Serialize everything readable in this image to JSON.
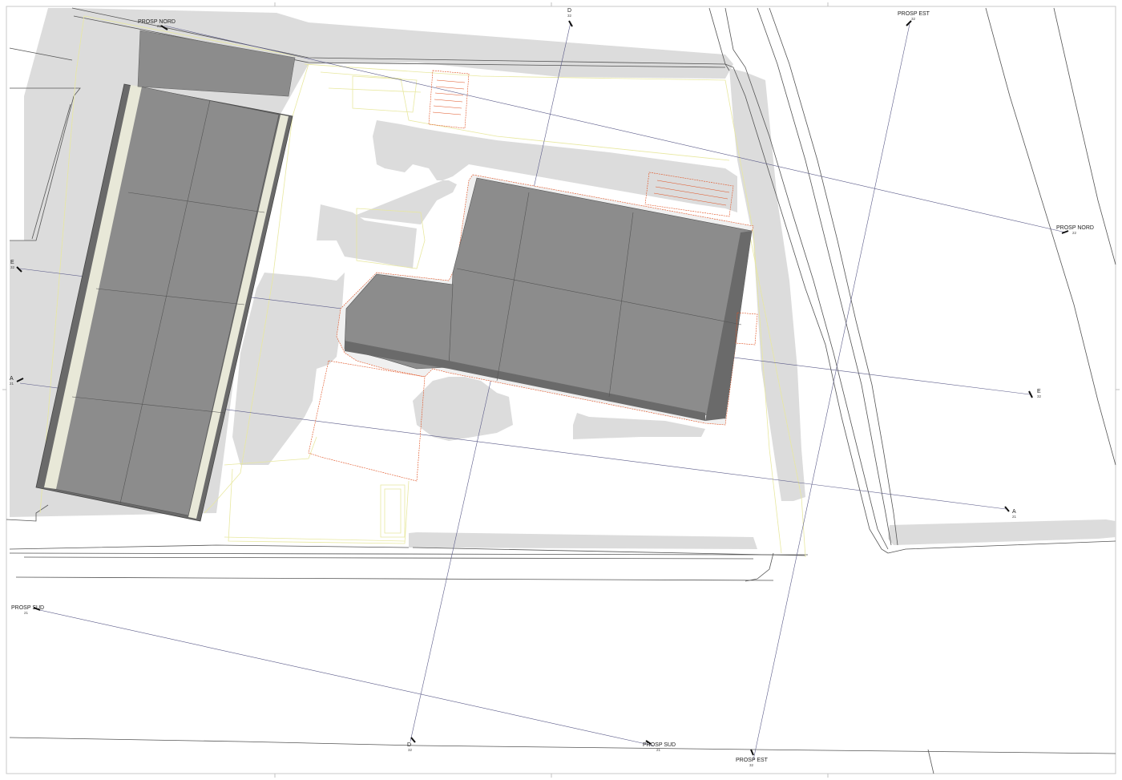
{
  "colors": {
    "background": "#ffffff",
    "shadow": "#dcdcdc",
    "roof": "#8c8c8c",
    "roof_dark": "#6a6a6a",
    "linework": "#555555",
    "construction": "#e8e8a0",
    "section_line": "#5a5a88",
    "red_detail": "#e05020"
  },
  "section_marks": [
    {
      "id": "prosp-nord-top",
      "label": "PROSP NORD",
      "sub": "22"
    },
    {
      "id": "prosp-nord-right",
      "label": "PROSP NORD",
      "sub": "22"
    },
    {
      "id": "prosp-est-top",
      "label": "PROSP EST",
      "sub": "32"
    },
    {
      "id": "prosp-est-bottom",
      "label": "PROSP EST",
      "sub": "32"
    },
    {
      "id": "prosp-sud-left",
      "label": "PROSP SUD",
      "sub": "21"
    },
    {
      "id": "prosp-sud-bottom",
      "label": "PROSP SUD",
      "sub": "21"
    },
    {
      "id": "d-top",
      "label": "D",
      "sub": "32"
    },
    {
      "id": "d-bottom",
      "label": "D",
      "sub": "32"
    },
    {
      "id": "e-left",
      "label": "E",
      "sub": "32"
    },
    {
      "id": "e-right",
      "label": "E",
      "sub": "32"
    },
    {
      "id": "a-left",
      "label": "A",
      "sub": "21"
    },
    {
      "id": "a-right",
      "label": "A",
      "sub": "21"
    }
  ]
}
